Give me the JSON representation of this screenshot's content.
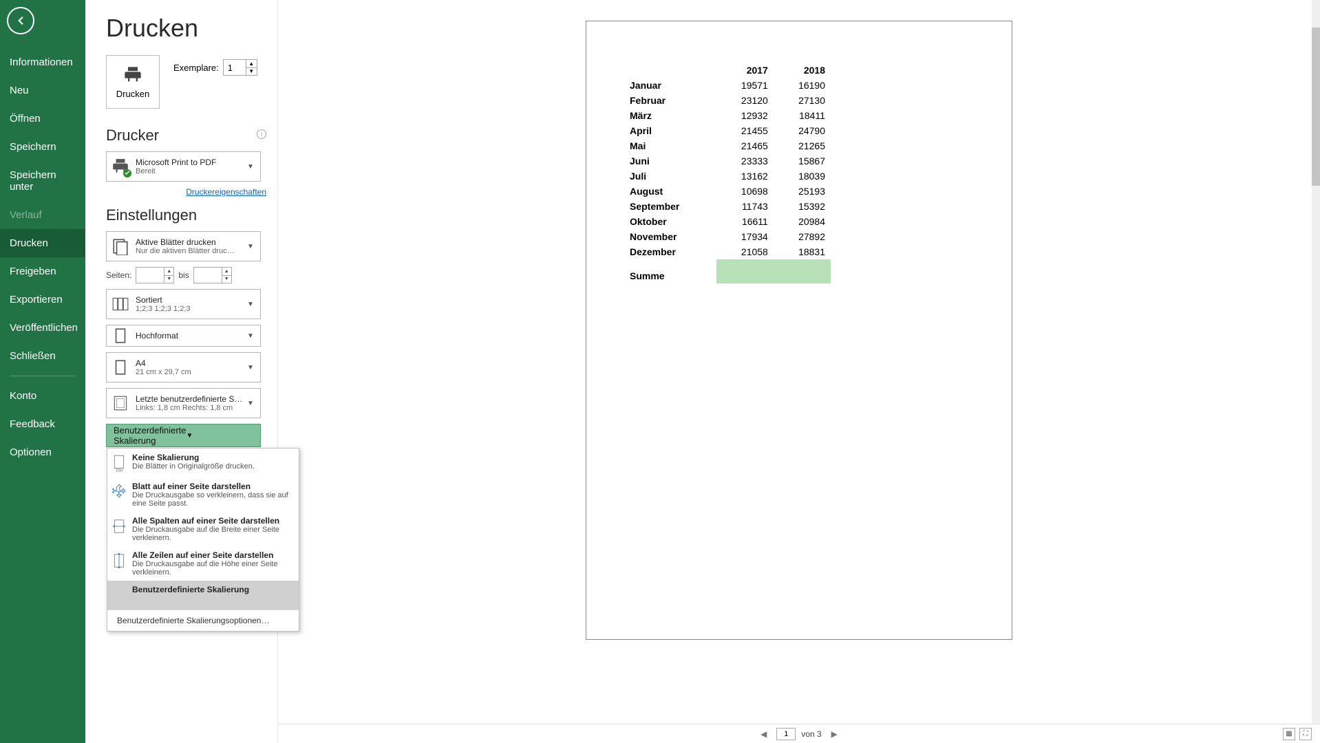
{
  "sidebar": {
    "items": [
      {
        "label": "Informationen"
      },
      {
        "label": "Neu"
      },
      {
        "label": "Öffnen"
      },
      {
        "label": "Speichern"
      },
      {
        "label": "Speichern unter"
      },
      {
        "label": "Verlauf",
        "disabled": true
      },
      {
        "label": "Drucken",
        "active": true
      },
      {
        "label": "Freigeben"
      },
      {
        "label": "Exportieren"
      },
      {
        "label": "Veröffentlichen"
      },
      {
        "label": "Schließen"
      }
    ],
    "bottom": [
      {
        "label": "Konto"
      },
      {
        "label": "Feedback"
      },
      {
        "label": "Optionen"
      }
    ]
  },
  "page": {
    "title": "Drucken"
  },
  "print_button": {
    "label": "Drucken"
  },
  "copies": {
    "label": "Exemplare:",
    "value": "1"
  },
  "printer": {
    "heading": "Drucker",
    "name": "Microsoft Print to PDF",
    "status": "Bereit",
    "props_link": "Druckereigenschaften"
  },
  "settings": {
    "heading": "Einstellungen",
    "what": {
      "line1": "Aktive Blätter drucken",
      "line2": "Nur die aktiven Blätter druc…"
    },
    "pages_label": "Seiten:",
    "pages_from": "",
    "pages_between": "bis",
    "pages_to": "",
    "collate": {
      "line1": "Sortiert",
      "line2": "1;2;3   1;2;3   1;2;3"
    },
    "orientation": {
      "line1": "Hochformat"
    },
    "paper": {
      "line1": "A4",
      "line2": "21 cm x 29,7 cm"
    },
    "margins": {
      "line1": "Letzte benutzerdefinierte Sei…",
      "line2": "Links: 1,8 cm   Rechts: 1,8 cm"
    },
    "scaling_current": "Benutzerdefinierte Skalierung",
    "scaling_menu": {
      "items": [
        {
          "title": "Keine Skalierung",
          "desc": "Die Blätter in Originalgröße drucken."
        },
        {
          "title": "Blatt auf einer Seite darstellen",
          "desc": "Die Druckausgabe so verkleinern, dass sie auf eine Seite passt."
        },
        {
          "title": "Alle Spalten auf einer Seite darstellen",
          "desc": "Die Druckausgabe auf die Breite einer Seite verkleinern."
        },
        {
          "title": "Alle Zeilen auf einer Seite darstellen",
          "desc": "Die Druckausgabe auf die Höhe einer Seite verkleinern."
        },
        {
          "title": "Benutzerdefinierte Skalierung",
          "desc": "",
          "selected": true
        }
      ],
      "footer": "Benutzerdefinierte Skalierungsoptionen…"
    }
  },
  "preview_nav": {
    "page": "1",
    "of": "von 3"
  },
  "chart_data": {
    "type": "table",
    "title": "",
    "columns": [
      "",
      "2017",
      "2018"
    ],
    "rows": [
      [
        "Januar",
        19571,
        16190
      ],
      [
        "Februar",
        23120,
        27130
      ],
      [
        "März",
        12932,
        18411
      ],
      [
        "April",
        21455,
        24790
      ],
      [
        "Mai",
        21465,
        21265
      ],
      [
        "Juni",
        23333,
        15867
      ],
      [
        "Juli",
        13162,
        18039
      ],
      [
        "August",
        10698,
        25193
      ],
      [
        "September",
        11743,
        15392
      ],
      [
        "Oktober",
        16611,
        20984
      ],
      [
        "November",
        17934,
        27892
      ],
      [
        "Dezember",
        21058,
        18831
      ]
    ],
    "sum_label": "Summe",
    "sum_highlight_color": "#b7e1b7"
  }
}
